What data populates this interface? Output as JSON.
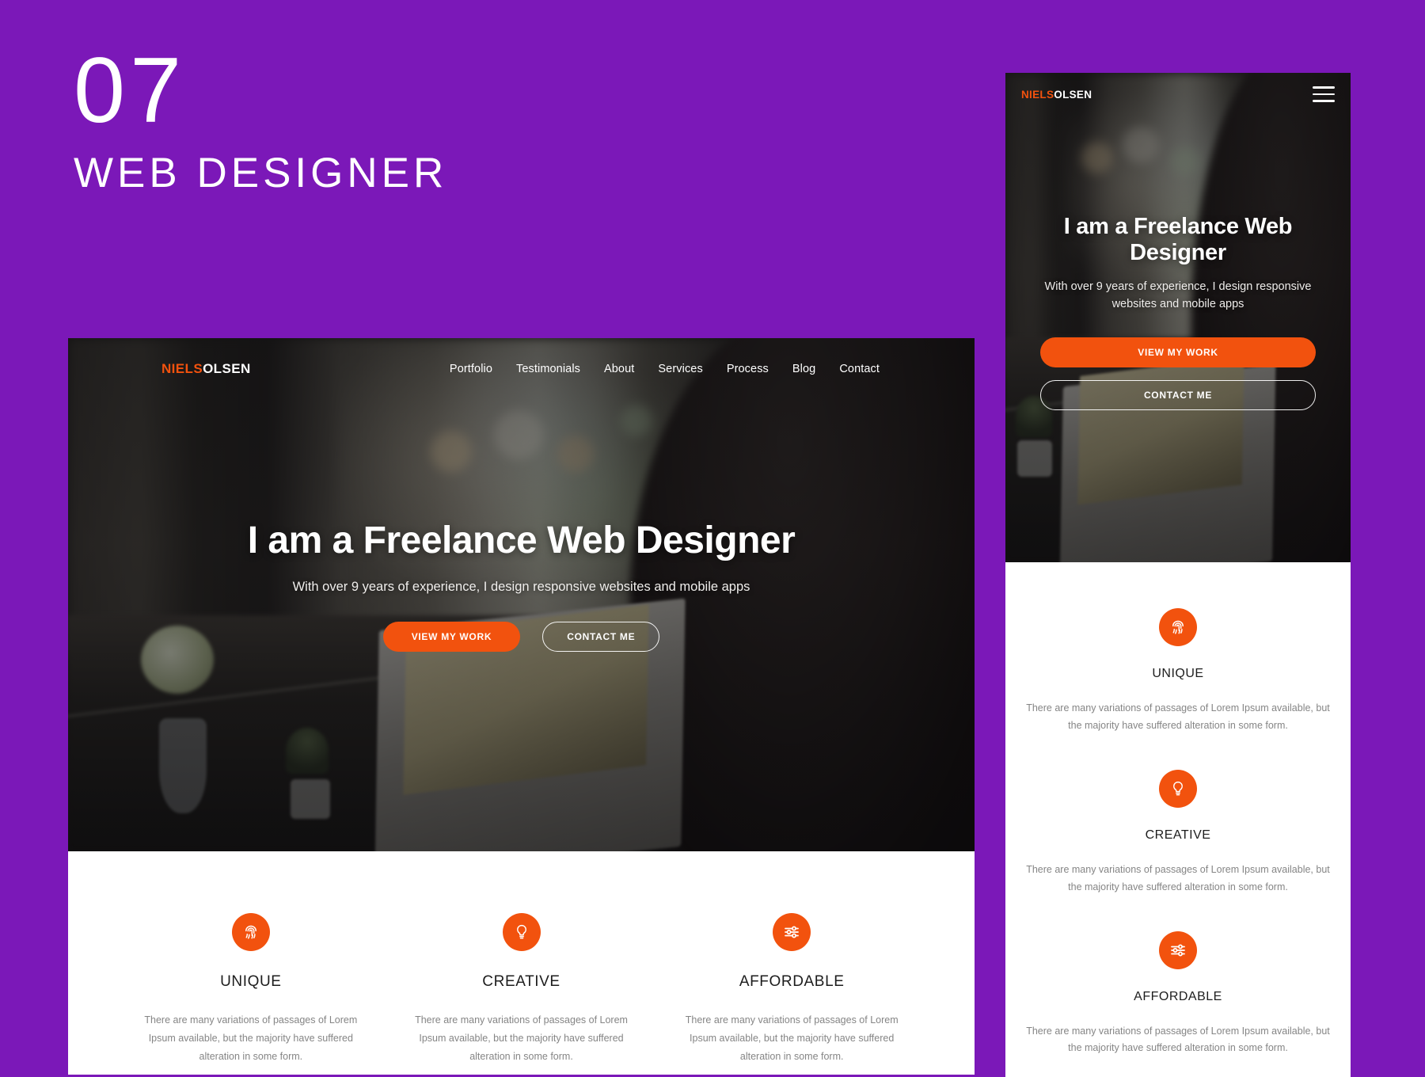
{
  "poster": {
    "number": "07",
    "category": "WEB DESIGNER",
    "background_color": "#7B18B8",
    "accent_color": "#F2520E"
  },
  "brand": {
    "name_first": "NIELS",
    "name_last": "OLSEN"
  },
  "desktop": {
    "nav": [
      {
        "label": "Portfolio"
      },
      {
        "label": "Testimonials"
      },
      {
        "label": "About"
      },
      {
        "label": "Services"
      },
      {
        "label": "Process"
      },
      {
        "label": "Blog"
      },
      {
        "label": "Contact"
      }
    ],
    "hero": {
      "heading": "I am a Freelance Web Designer",
      "subheading": "With over 9 years of experience, I design responsive websites and mobile apps",
      "primary_button": "VIEW MY WORK",
      "secondary_button": "CONTACT ME"
    },
    "features": [
      {
        "icon": "fingerprint-icon",
        "title": "UNIQUE",
        "text": "There are many variations of passages of Lorem Ipsum available, but the majority have suffered alteration in some form."
      },
      {
        "icon": "lightbulb-icon",
        "title": "CREATIVE",
        "text": "There are many variations of passages of Lorem Ipsum available, but the majority have suffered alteration in some form."
      },
      {
        "icon": "sliders-icon",
        "title": "AFFORDABLE",
        "text": "There are many variations of passages of Lorem Ipsum available, but the majority have suffered alteration in some form."
      }
    ]
  },
  "mobile": {
    "menu_icon": "hamburger-menu-icon",
    "hero": {
      "heading": "I am a Freelance Web Designer",
      "subheading": "With over 9 years of experience, I design responsive websites and mobile apps",
      "primary_button": "VIEW MY WORK",
      "secondary_button": "CONTACT ME"
    },
    "features": [
      {
        "icon": "fingerprint-icon",
        "title": "UNIQUE",
        "text": "There are many variations of passages of Lorem Ipsum available, but the majority have suffered alteration in some form."
      },
      {
        "icon": "lightbulb-icon",
        "title": "CREATIVE",
        "text": "There are many variations of passages of Lorem Ipsum available, but the majority have suffered alteration in some form."
      },
      {
        "icon": "sliders-icon",
        "title": "AFFORDABLE",
        "text": "There are many variations of passages of Lorem Ipsum available, but the majority have suffered alteration in some form."
      }
    ]
  }
}
